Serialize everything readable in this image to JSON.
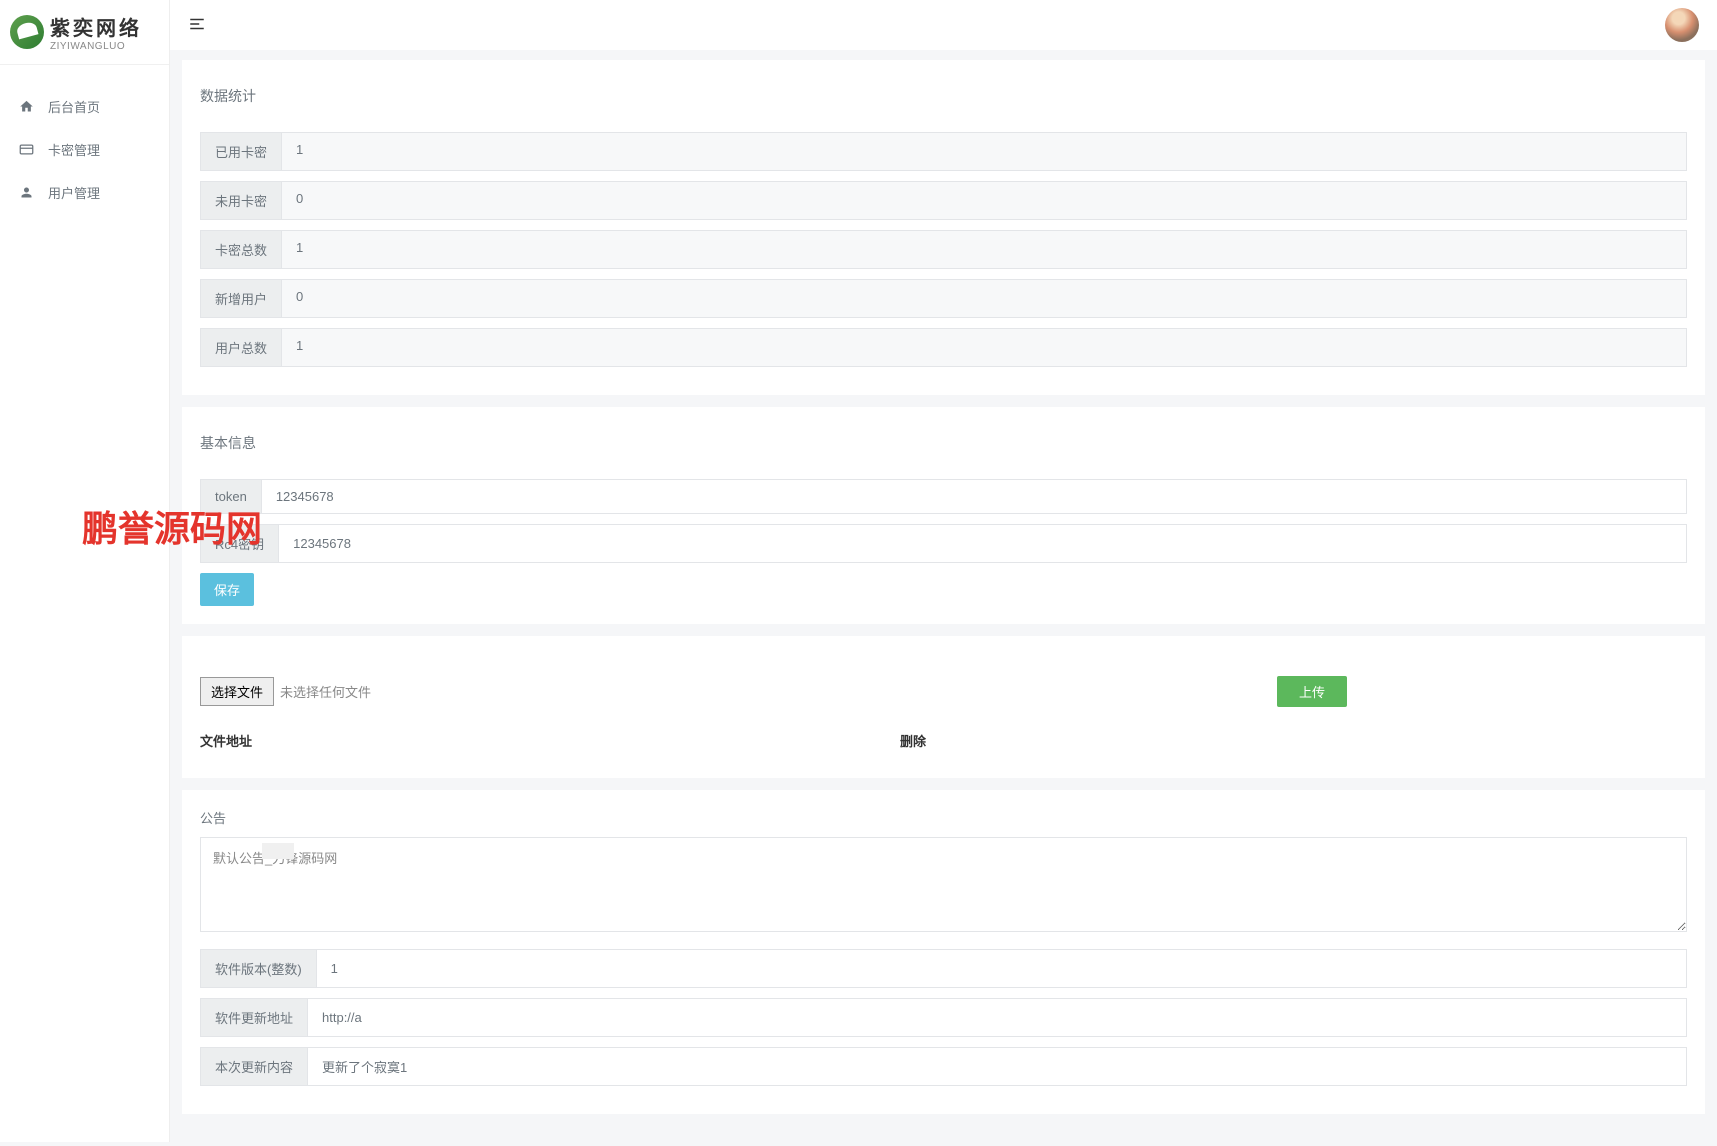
{
  "brand": {
    "cn": "紫奕网络",
    "en": "ZIYIWANGLUO"
  },
  "sidebar": {
    "items": [
      {
        "label": "后台首页",
        "icon": "home"
      },
      {
        "label": "卡密管理",
        "icon": "card"
      },
      {
        "label": "用户管理",
        "icon": "user"
      }
    ]
  },
  "stats": {
    "title": "数据统计",
    "rows": [
      {
        "label": "已用卡密",
        "value": "1"
      },
      {
        "label": "未用卡密",
        "value": "0"
      },
      {
        "label": "卡密总数",
        "value": "1"
      },
      {
        "label": "新增用户",
        "value": "0"
      },
      {
        "label": "用户总数",
        "value": "1"
      }
    ]
  },
  "basic": {
    "title": "基本信息",
    "token_label": "token",
    "token_value": "12345678",
    "rc4_label": "Rc4密钥",
    "rc4_value": "12345678",
    "save_label": "保存"
  },
  "upload": {
    "choose_file": "选择文件",
    "no_file": "未选择任何文件",
    "upload_label": "上传",
    "col_address": "文件地址",
    "col_delete": "删除"
  },
  "announce": {
    "label": "公告",
    "value": "默认公告_刀锋源码网"
  },
  "version": {
    "version_label": "软件版本(整数)",
    "version_value": "1",
    "update_url_label": "软件更新地址",
    "update_url_value": "http://a",
    "update_content_label": "本次更新内容",
    "update_content_value": "更新了个寂寞1"
  },
  "watermark": "鹏誉源码网"
}
